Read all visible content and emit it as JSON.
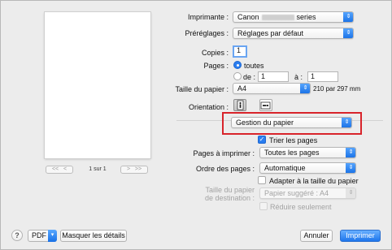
{
  "printer": {
    "label": "Imprimante :",
    "value_prefix": "Canon",
    "value_suffix": "series"
  },
  "presets": {
    "label": "Préréglages :",
    "value": "Réglages par défaut"
  },
  "copies": {
    "label": "Copies :",
    "value": "1"
  },
  "pages": {
    "label": "Pages :",
    "all": "toutes",
    "from_label": "de :",
    "from_value": "1",
    "to_label": "à :",
    "to_value": "1"
  },
  "paper_size": {
    "label": "Taille du papier :",
    "value": "A4",
    "dimensions": "210 par 297 mm"
  },
  "orientation": {
    "label": "Orientation :"
  },
  "section_popup": {
    "value": "Gestion du papier"
  },
  "collate": {
    "label": "Trier les pages",
    "checked": true
  },
  "pages_to_print": {
    "label": "Pages à imprimer :",
    "value": "Toutes les pages"
  },
  "page_order": {
    "label": "Ordre des pages :",
    "value": "Automatique"
  },
  "scale_to_fit": {
    "label": "Adapter à la taille du papier",
    "checked": false
  },
  "destination_size": {
    "label_line1": "Taille du papier",
    "label_line2": "de destination :",
    "value": "Papier suggéré : A4"
  },
  "scale_down_only": {
    "label": "Réduire seulement",
    "checked": false
  },
  "preview_nav": {
    "first": "<<",
    "prev": "<",
    "count": "1 sur 1",
    "next": ">",
    "last": ">>"
  },
  "footer": {
    "help": "?",
    "pdf": "PDF",
    "details": "Masquer les détails",
    "cancel": "Annuler",
    "print": "Imprimer"
  },
  "colors": {
    "accent": "#2a7ef0",
    "highlight_box": "#d8242b"
  }
}
